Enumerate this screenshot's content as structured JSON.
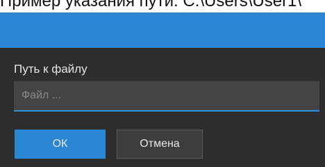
{
  "caption": "Пример указания пути: C:\\Users\\User1\\",
  "dialog": {
    "field_label": "Путь к файлу",
    "file_input": {
      "value": "",
      "placeholder": "Файл ..."
    },
    "ok_label": "ОК",
    "cancel_label": "Отмена"
  },
  "colors": {
    "accent": "#2b86d3",
    "dialog_background": "#2d2d30",
    "input_background": "#444446",
    "cancel_background": "#3d3d40"
  }
}
